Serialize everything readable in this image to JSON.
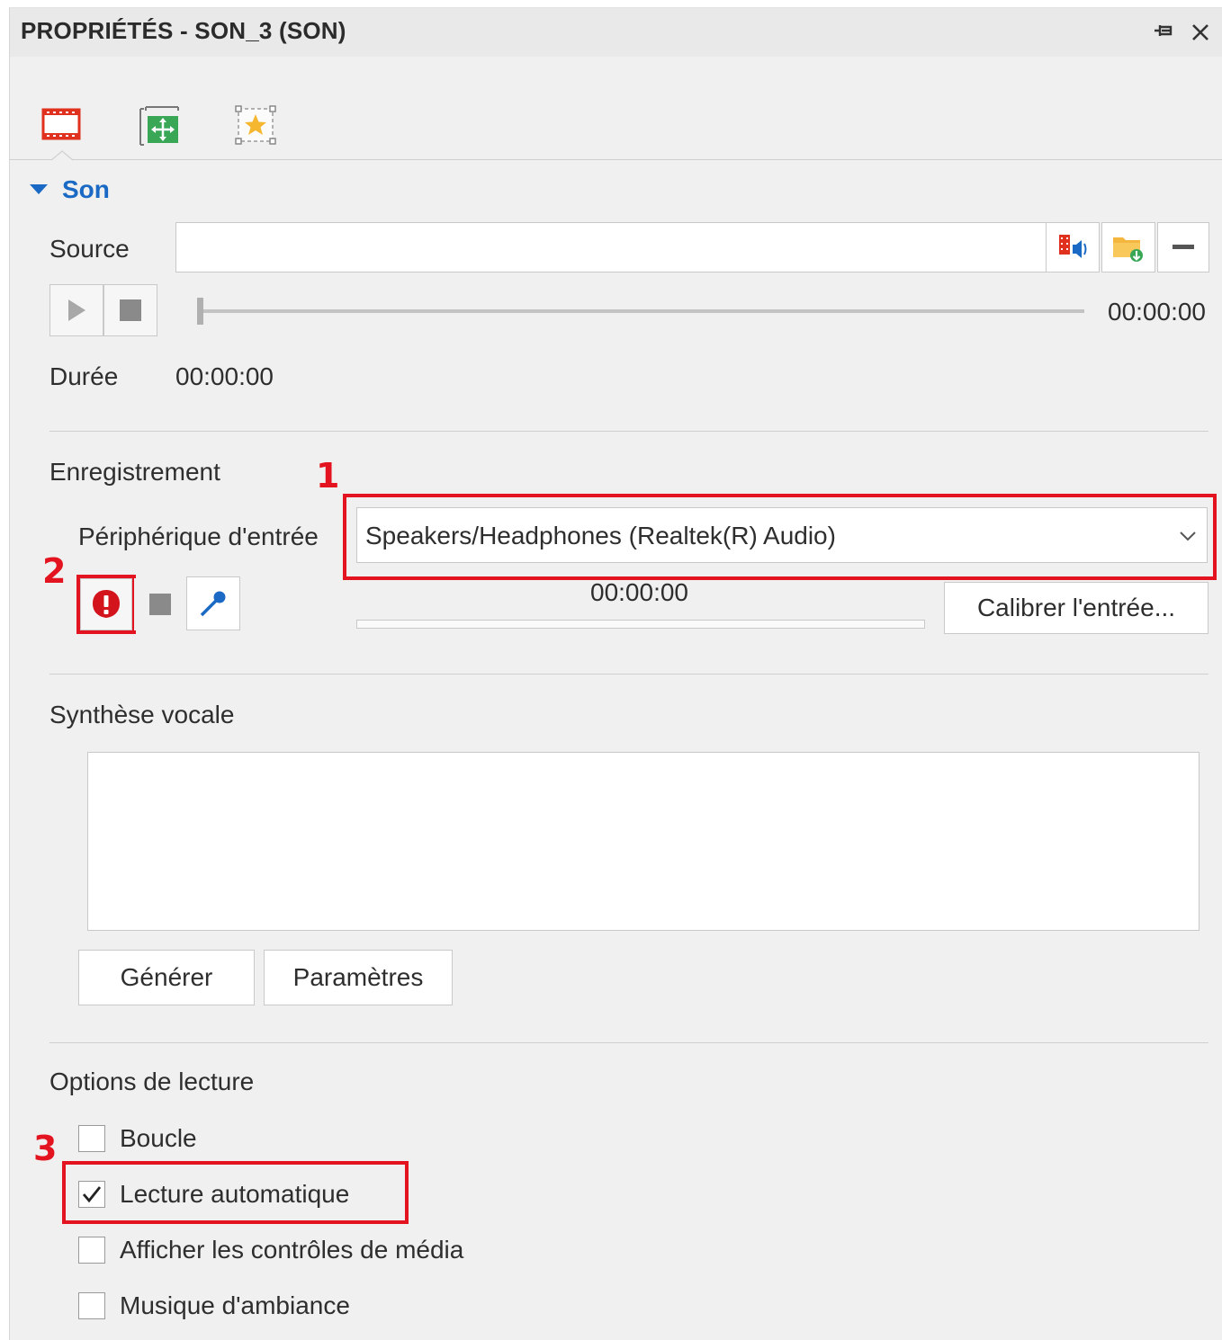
{
  "panel": {
    "title": "PROPRIÉTÉS - SON_3 (SON)"
  },
  "tabs": [
    {
      "icon": "film-strip-icon",
      "active": true
    },
    {
      "icon": "move-frame-icon",
      "active": false
    },
    {
      "icon": "star-frame-icon",
      "active": false
    }
  ],
  "section": {
    "title": "Son"
  },
  "source": {
    "label": "Source",
    "value": ""
  },
  "player": {
    "time": "00:00:00",
    "progress": 0
  },
  "duration": {
    "label": "Durée",
    "value": "00:00:00"
  },
  "recording": {
    "header": "Enregistrement",
    "device_label": "Périphérique d'entrée",
    "device_value": "Speakers/Headphones (Realtek(R) Audio)",
    "time": "00:00:00",
    "calibrate_label": "Calibrer l'entrée..."
  },
  "tts": {
    "header": "Synthèse vocale",
    "text": "",
    "generate_label": "Générer",
    "params_label": "Paramètres"
  },
  "playback": {
    "header": "Options de lecture",
    "options": [
      {
        "label": "Boucle",
        "checked": false
      },
      {
        "label": "Lecture automatique",
        "checked": true
      },
      {
        "label": "Afficher les contrôles de média",
        "checked": false
      },
      {
        "label": "Musique d'ambiance",
        "checked": false
      }
    ]
  },
  "annotations": {
    "one": "1",
    "two": "2",
    "three": "3",
    "color": "#e3141f"
  }
}
